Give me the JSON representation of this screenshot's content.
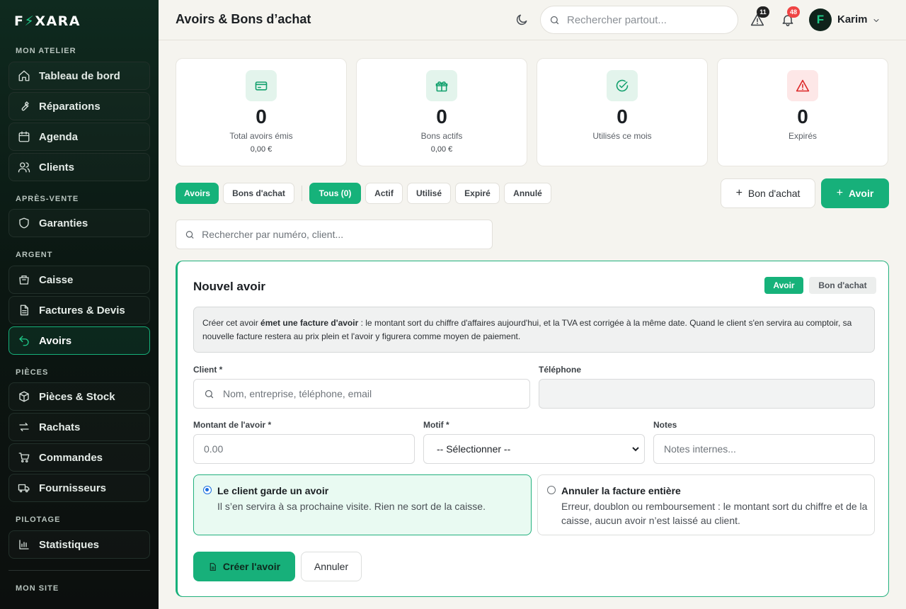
{
  "brand": {
    "name_left": "F",
    "bolt": "⚡",
    "name_right": "XARA"
  },
  "sidebar": {
    "sections": [
      "MON ATELIER",
      "APRÈS-VENTE",
      "ARGENT",
      "PIÈCES",
      "PILOTAGE",
      "MON SITE"
    ],
    "items": [
      {
        "label": "Tableau de bord",
        "icon": "home-icon"
      },
      {
        "label": "Réparations",
        "icon": "wrench-icon"
      },
      {
        "label": "Agenda",
        "icon": "calendar-icon"
      },
      {
        "label": "Clients",
        "icon": "users-icon"
      },
      {
        "label": "Garanties",
        "icon": "shield-icon"
      },
      {
        "label": "Caisse",
        "icon": "cash-register-icon"
      },
      {
        "label": "Factures & Devis",
        "icon": "document-icon"
      },
      {
        "label": "Avoirs",
        "icon": "undo-icon"
      },
      {
        "label": "Pièces & Stock",
        "icon": "box-icon"
      },
      {
        "label": "Rachats",
        "icon": "exchange-icon"
      },
      {
        "label": "Commandes",
        "icon": "cart-icon"
      },
      {
        "label": "Fournisseurs",
        "icon": "truck-icon"
      },
      {
        "label": "Statistiques",
        "icon": "bar-chart-icon"
      }
    ]
  },
  "header": {
    "title": "Avoirs & Bons d’achat",
    "search_placeholder": "Rechercher partout...",
    "alerts_count": "11",
    "notifications_count": "48",
    "user_initial": "F",
    "user_name": "Karim"
  },
  "stats": [
    {
      "value": "0",
      "label": "Total avoirs émis",
      "sub": "0,00 €",
      "icon": "credit-card-icon"
    },
    {
      "value": "0",
      "label": "Bons actifs",
      "sub": "0,00 €",
      "icon": "gift-icon"
    },
    {
      "value": "0",
      "label": "Utilisés ce mois",
      "sub": "",
      "icon": "check-circle-icon"
    },
    {
      "value": "0",
      "label": "Expirés",
      "sub": "",
      "icon": "warning-icon"
    }
  ],
  "filters": {
    "types": [
      "Avoirs",
      "Bons d'achat"
    ],
    "statuses": [
      "Tous (0)",
      "Actif",
      "Utilisé",
      "Expiré",
      "Annulé"
    ],
    "new_voucher": "Bon d'achat",
    "new_credit": "Avoir",
    "search_placeholder": "Rechercher par numéro, client..."
  },
  "form": {
    "title": "Nouvel avoir",
    "toggle": [
      "Avoir",
      "Bon d'achat"
    ],
    "info_pre": "Créer cet avoir ",
    "info_bold": "émet une facture d'avoir",
    "info_post": " : le montant sort du chiffre d'affaires aujourd'hui, et la TVA est corrigée à la même date. Quand le client s'en servira au comptoir, sa nouvelle facture restera au prix plein et l'avoir y figurera comme moyen de paiement.",
    "client_label": "Client *",
    "client_placeholder": "Nom, entreprise, téléphone, email",
    "phone_label": "Téléphone",
    "amount_label": "Montant de l'avoir *",
    "amount_placeholder": "0.00",
    "reason_label": "Motif *",
    "reason_selected": "-- Sélectionner --",
    "notes_label": "Notes",
    "notes_placeholder": "Notes internes...",
    "option1_title": "Le client garde un avoir",
    "option1_desc": "Il s’en servira à sa prochaine visite. Rien ne sort de la caisse.",
    "option2_title": "Annuler la facture entière",
    "option2_desc": "Erreur, doublon ou remboursement : le montant sort du chiffre et de la caisse, aucun avoir n’est laissé au client.",
    "create_button": "Créer l'avoir",
    "cancel_button": "Annuler"
  },
  "colors": {
    "accent": "#17b07a",
    "sidebar_bg": "#0c1712",
    "danger": "#dc2626"
  }
}
